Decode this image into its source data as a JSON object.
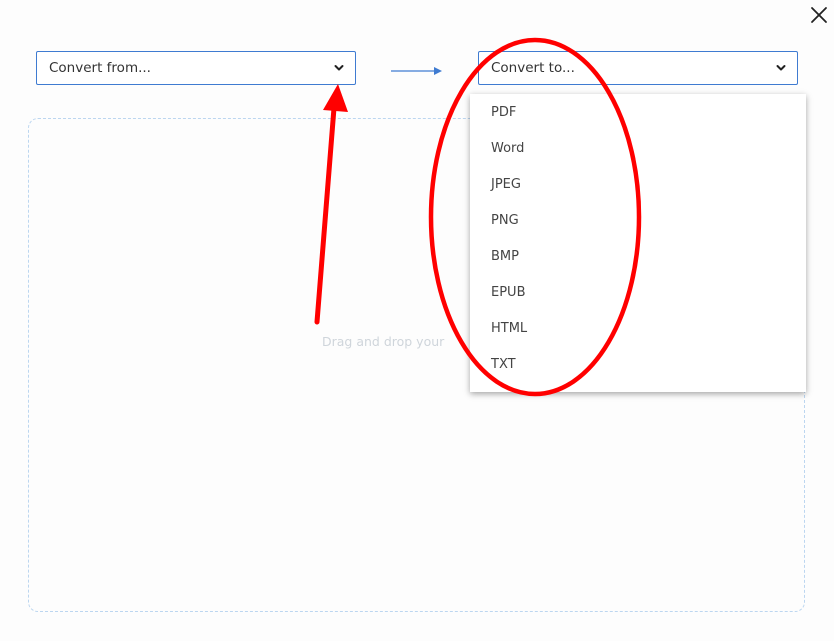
{
  "close_button": {
    "icon": "close-icon"
  },
  "converter": {
    "from_select": {
      "label": "Convert from...",
      "icon": "chevron-down-icon"
    },
    "to_select": {
      "label": "Convert to...",
      "icon": "chevron-down-icon"
    },
    "arrow_icon": "arrow-right-icon",
    "accent_color": "#3f7bd1"
  },
  "dropzone": {
    "text": "Drag and drop your"
  },
  "dropdown": {
    "items": [
      "PDF",
      "Word",
      "JPEG",
      "PNG",
      "BMP",
      "EPUB",
      "HTML",
      "TXT"
    ]
  },
  "annotations": {
    "color": "#ff0000",
    "arrow": "red-arrow-pointing-to-convert-from",
    "ellipse": "red-ellipse-around-convert-to-options"
  }
}
